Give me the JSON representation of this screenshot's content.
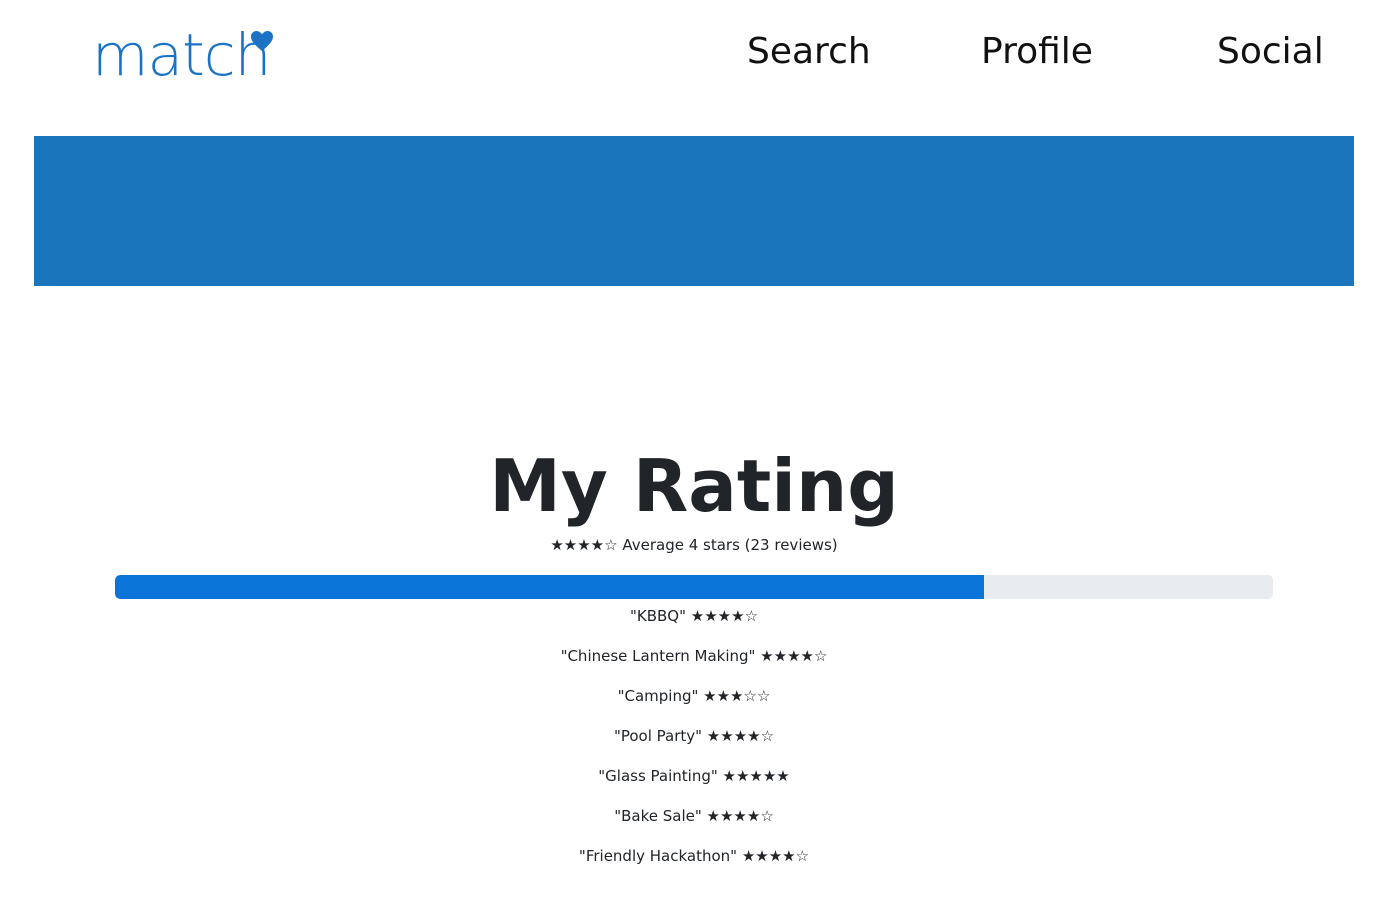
{
  "header": {
    "logo_text": "match",
    "nav": {
      "search": "Search",
      "profile": "Profile",
      "social": "Social"
    }
  },
  "colors": {
    "brand": "#1a73c4",
    "banner": "#1a75bc",
    "progress_fill": "#0b74d9",
    "progress_track": "#e9ecef"
  },
  "rating": {
    "title": "My Rating",
    "summary": "★★★★☆ Average 4 stars (23 reviews)",
    "progress_fraction": 0.75,
    "reviews": [
      "\"KBBQ\" ★★★★☆",
      "\"Chinese Lantern Making\" ★★★★☆",
      "\"Camping\" ★★★☆☆",
      "\"Pool Party\" ★★★★☆",
      "\"Glass Painting\" ★★★★★",
      "\"Bake Sale\" ★★★★☆",
      "\"Friendly Hackathon\" ★★★★☆"
    ]
  }
}
